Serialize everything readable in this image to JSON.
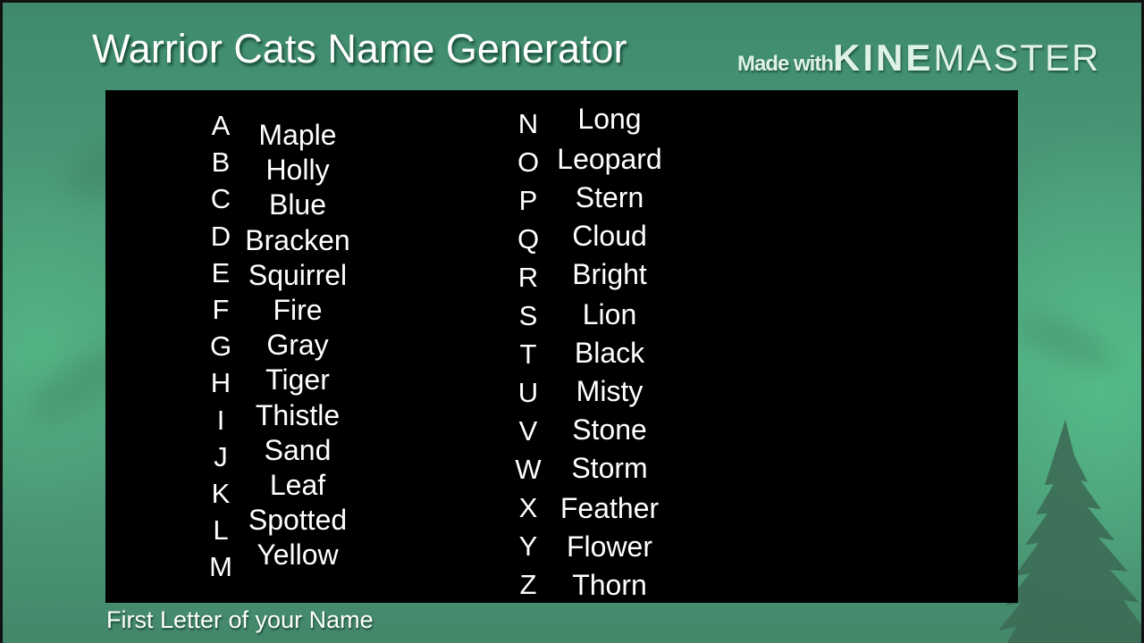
{
  "title": "Warrior Cats Name Generator",
  "watermark": {
    "prefix": "Made with",
    "brand_bold": "KINE",
    "brand_light": "MASTER"
  },
  "caption": "First Letter of your Name",
  "colors": {
    "background_green": "#4a9a78",
    "panel": "#000000",
    "text": "#ffffff",
    "watermark": "#dff2ea"
  },
  "left_column": [
    {
      "letter": "A",
      "name": "Maple"
    },
    {
      "letter": "B",
      "name": "Holly"
    },
    {
      "letter": "C",
      "name": "Blue"
    },
    {
      "letter": "D",
      "name": "Bracken"
    },
    {
      "letter": "E",
      "name": "Squirrel"
    },
    {
      "letter": "F",
      "name": "Fire"
    },
    {
      "letter": "G",
      "name": "Gray"
    },
    {
      "letter": "H",
      "name": "Tiger"
    },
    {
      "letter": "I",
      "name": "Thistle"
    },
    {
      "letter": "J",
      "name": "Sand"
    },
    {
      "letter": "K",
      "name": "Leaf"
    },
    {
      "letter": "L",
      "name": "Spotted"
    },
    {
      "letter": "M",
      "name": "Yellow"
    }
  ],
  "right_column": [
    {
      "letter": "N",
      "name": "Long"
    },
    {
      "letter": "O",
      "name": "Leopard"
    },
    {
      "letter": "P",
      "name": "Stern"
    },
    {
      "letter": "Q",
      "name": "Cloud"
    },
    {
      "letter": "R",
      "name": "Bright"
    },
    {
      "letter": "S",
      "name": "Lion"
    },
    {
      "letter": "T",
      "name": "Black"
    },
    {
      "letter": "U",
      "name": "Misty"
    },
    {
      "letter": "V",
      "name": "Stone"
    },
    {
      "letter": "W",
      "name": "Storm"
    },
    {
      "letter": "X",
      "name": "Feather"
    },
    {
      "letter": "Y",
      "name": "Flower"
    },
    {
      "letter": "Z",
      "name": "Thorn"
    }
  ]
}
